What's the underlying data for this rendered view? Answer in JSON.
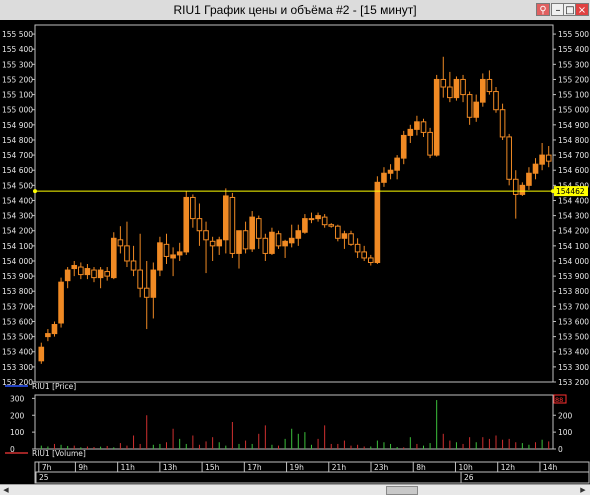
{
  "window": {
    "title": "RIU1 График цены и объёма #2 - [15 минут]",
    "buttons": {
      "pin": "⚲",
      "minimize": "–",
      "maximize": "□",
      "close": "×"
    }
  },
  "colors": {
    "background": "#000000",
    "candle": "#f08a24",
    "axis_text": "#e8e8e8",
    "last_price_line": "#ffff00",
    "volume_up": "#3cc03c",
    "volume_down": "#d03030",
    "volume_marker": "#ff3030",
    "frame": "#c0c0c0"
  },
  "chart_data": [
    {
      "type": "candlestick",
      "legend": "RIU1 [Price]",
      "ylim": [
        153200,
        155560
      ],
      "yticks": [
        153200,
        153300,
        153400,
        153500,
        153600,
        153700,
        153800,
        153900,
        154000,
        154100,
        154200,
        154300,
        154400,
        154500,
        154600,
        154700,
        154800,
        154900,
        155000,
        155100,
        155200,
        155300,
        155400,
        155500
      ],
      "last_price": 154462,
      "last_price_label": "154462",
      "candles": [
        [
          153340,
          153460,
          153320,
          153430
        ],
        [
          153500,
          153550,
          153470,
          153520
        ],
        [
          153520,
          153600,
          153500,
          153580
        ],
        [
          153590,
          153890,
          153560,
          153860
        ],
        [
          153870,
          153960,
          153820,
          153940
        ],
        [
          153950,
          154000,
          153900,
          153970
        ],
        [
          153960,
          153990,
          153880,
          153910
        ],
        [
          153910,
          153980,
          153880,
          153950
        ],
        [
          153940,
          153960,
          153860,
          153890
        ],
        [
          153890,
          153960,
          153820,
          153940
        ],
        [
          153930,
          153960,
          153870,
          153900
        ],
        [
          153890,
          154190,
          153880,
          154150
        ],
        [
          154140,
          154230,
          154050,
          154100
        ],
        [
          154100,
          154260,
          153960,
          154000
        ],
        [
          154000,
          154100,
          153900,
          153940
        ],
        [
          153940,
          154180,
          153760,
          153820
        ],
        [
          153820,
          154000,
          153550,
          153760
        ],
        [
          153760,
          153990,
          153620,
          153940
        ],
        [
          153940,
          154160,
          153900,
          154120
        ],
        [
          154110,
          154180,
          153980,
          154030
        ],
        [
          154020,
          154090,
          153900,
          154040
        ],
        [
          154040,
          154120,
          154000,
          154060
        ],
        [
          154060,
          154460,
          154040,
          154420
        ],
        [
          154420,
          154440,
          154220,
          154280
        ],
        [
          154280,
          154380,
          154100,
          154200
        ],
        [
          154200,
          154260,
          153920,
          154140
        ],
        [
          154130,
          154160,
          154000,
          154100
        ],
        [
          154100,
          154160,
          154040,
          154140
        ],
        [
          154140,
          154480,
          154050,
          154430
        ],
        [
          154420,
          154450,
          154020,
          154050
        ],
        [
          154050,
          154150,
          153950,
          154200
        ],
        [
          154200,
          154260,
          154050,
          154080
        ],
        [
          154080,
          154330,
          154060,
          154290
        ],
        [
          154280,
          154300,
          154080,
          154150
        ],
        [
          154150,
          154180,
          154000,
          154050
        ],
        [
          154050,
          154220,
          154040,
          154190
        ],
        [
          154180,
          154200,
          154080,
          154100
        ],
        [
          154100,
          154140,
          154020,
          154130
        ],
        [
          154120,
          154240,
          154090,
          154150
        ],
        [
          154150,
          154240,
          154100,
          154200
        ],
        [
          154190,
          154310,
          154180,
          154280
        ],
        [
          154280,
          154320,
          154250,
          154280
        ],
        [
          154280,
          154320,
          154260,
          154300
        ],
        [
          154290,
          154310,
          154220,
          154240
        ],
        [
          154240,
          154250,
          154220,
          154230
        ],
        [
          154230,
          154240,
          154130,
          154150
        ],
        [
          154150,
          154200,
          154080,
          154180
        ],
        [
          154180,
          154200,
          154100,
          154110
        ],
        [
          154110,
          154150,
          154020,
          154060
        ],
        [
          154060,
          154100,
          154000,
          154020
        ],
        [
          154020,
          154040,
          153970,
          153990
        ],
        [
          153990,
          154560,
          153980,
          154520
        ],
        [
          154520,
          154620,
          154490,
          154580
        ],
        [
          154580,
          154640,
          154540,
          154600
        ],
        [
          154600,
          154700,
          154540,
          154680
        ],
        [
          154680,
          154860,
          154640,
          154830
        ],
        [
          154830,
          154900,
          154780,
          154870
        ],
        [
          154870,
          154960,
          154830,
          154920
        ],
        [
          154920,
          154940,
          154820,
          154850
        ],
        [
          154850,
          154880,
          154680,
          154700
        ],
        [
          154700,
          155230,
          154690,
          155200
        ],
        [
          155200,
          155350,
          155080,
          155150
        ],
        [
          155150,
          155250,
          155050,
          155080
        ],
        [
          155080,
          155220,
          155060,
          155200
        ],
        [
          155200,
          155230,
          155050,
          155100
        ],
        [
          155100,
          155120,
          154900,
          154950
        ],
        [
          154950,
          155100,
          154920,
          155050
        ],
        [
          155050,
          155240,
          155020,
          155200
        ],
        [
          155200,
          155260,
          155100,
          155120
        ],
        [
          155120,
          155150,
          154980,
          155000
        ],
        [
          155000,
          155040,
          154800,
          154820
        ],
        [
          154820,
          154840,
          154500,
          154540
        ],
        [
          154540,
          154600,
          154280,
          154440
        ],
        [
          154440,
          154520,
          154430,
          154500
        ],
        [
          154500,
          154620,
          154470,
          154580
        ],
        [
          154580,
          154680,
          154540,
          154640
        ],
        [
          154640,
          154780,
          154600,
          154700
        ],
        [
          154700,
          154760,
          154620,
          154660
        ]
      ]
    },
    {
      "type": "bar",
      "legend": "RIU1 [Volume]",
      "ylim": [
        0,
        320
      ],
      "yticks": [
        0,
        100,
        200,
        300
      ],
      "right_yticks": [
        0,
        100,
        200
      ],
      "marker_label": "88",
      "values": [
        20,
        15,
        30,
        25,
        18,
        20,
        10,
        15,
        12,
        14,
        18,
        10,
        35,
        20,
        80,
        30,
        200,
        25,
        30,
        40,
        120,
        60,
        30,
        80,
        25,
        45,
        70,
        40,
        20,
        160,
        30,
        50,
        30,
        90,
        140,
        25,
        20,
        60,
        120,
        90,
        100,
        25,
        60,
        140,
        30,
        30,
        50,
        20,
        25,
        15,
        15,
        50,
        40,
        30,
        12,
        10,
        70,
        30,
        20,
        35,
        290,
        90,
        50,
        40,
        30,
        70,
        40,
        70,
        60,
        80,
        55,
        60,
        40,
        35,
        25,
        40,
        55,
        45
      ],
      "colors": [
        "g",
        "g",
        "r",
        "g",
        "g",
        "r",
        "g",
        "r",
        "r",
        "g",
        "r",
        "g",
        "r",
        "r",
        "r",
        "r",
        "r",
        "g",
        "g",
        "r",
        "r",
        "g",
        "g",
        "r",
        "r",
        "r",
        "r",
        "g",
        "g",
        "r",
        "g",
        "r",
        "g",
        "r",
        "r",
        "g",
        "r",
        "g",
        "g",
        "g",
        "g",
        "g",
        "r",
        "r",
        "r",
        "r",
        "r",
        "r",
        "r",
        "r",
        "g",
        "g",
        "g",
        "g",
        "g",
        "r",
        "g",
        "r",
        "g",
        "g",
        "g",
        "r",
        "r",
        "g",
        "r",
        "r",
        "g",
        "r",
        "r",
        "r",
        "r",
        "r",
        "r",
        "g",
        "g",
        "r",
        "g",
        "r"
      ]
    }
  ],
  "time_axis": {
    "labels": [
      "7h",
      "9h",
      "11h",
      "13h",
      "15h",
      "17h",
      "19h",
      "21h",
      "23h",
      "8h",
      "10h",
      "12h",
      "14h"
    ],
    "label_indices": [
      0.5,
      7,
      14.5,
      22,
      29.5,
      37,
      44.5,
      52,
      59.5,
      67,
      74.5,
      82,
      89.5
    ],
    "dates": [
      {
        "text": "25",
        "index": 0
      },
      {
        "text": "26",
        "index": 64
      }
    ]
  },
  "scrollbar": {
    "left": "◀",
    "right": "▶",
    "grip": "|||"
  }
}
